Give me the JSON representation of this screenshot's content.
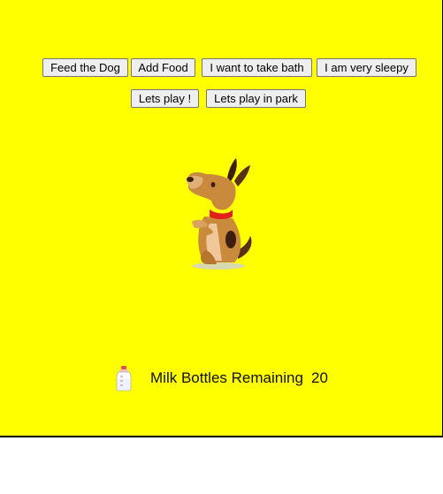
{
  "buttons": {
    "feed_dog": "Feed the Dog",
    "add_food": "Add Food",
    "take_bath": "I want to take bath",
    "very_sleepy": "I am very sleepy",
    "lets_play": "Lets play !",
    "play_in_park": "Lets play in park"
  },
  "milk": {
    "label": "Milk Bottles Remaining",
    "count": "20"
  },
  "colors": {
    "background": "#ffff00",
    "dog_body": "#c98a3c",
    "dog_collar": "#e0201a"
  },
  "icons": {
    "dog": "dog-image",
    "bottle": "milk-bottle-icon"
  }
}
